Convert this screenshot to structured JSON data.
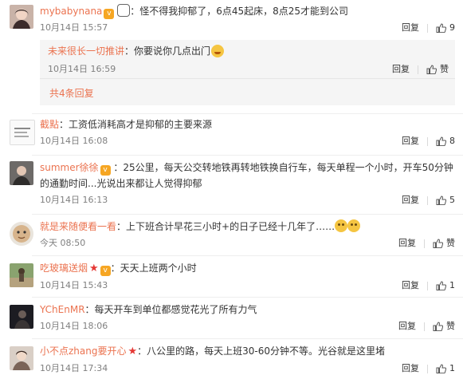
{
  "comments": [
    {
      "user": "mybabynana",
      "text": "：怪不得我抑郁了，6点45起床，8点25才能到公司",
      "time": "10月14日 15:57",
      "reply_label": "回复",
      "likes": "9",
      "sub": {
        "user": "未来很长一切推讲",
        "text": "：你要说你几点出门",
        "time": "10月14日 16:59",
        "reply_label": "回复",
        "like_label": "赞"
      },
      "more_replies": "共4条回复"
    },
    {
      "user": "截點",
      "text": "：工资低消耗高才是抑郁的主要来源",
      "time": "10月14日 16:08",
      "reply_label": "回复",
      "likes": "8"
    },
    {
      "user": "summer徐徐",
      "text": "：25公里，每天公交转地铁再转地铁换自行车，每天单程一个小时，开车50分钟",
      "text2": "的通勤时间...光说出来都让人觉得抑郁",
      "time": "10月14日 16:13",
      "reply_label": "回复",
      "likes": "5"
    },
    {
      "user": "就是来随便看一看",
      "text": "：上下班合计早花三小时+的日子已经十几年了……",
      "time": "今天 08:50",
      "reply_label": "回复",
      "like_label": "赞"
    },
    {
      "user": "吃玻璃送烟",
      "text": "：天天上班两个小时",
      "time": "10月14日 15:43",
      "reply_label": "回复",
      "likes": "1"
    },
    {
      "user": "YChEnMR",
      "text": "：每天开车到单位都感觉花光了所有力气",
      "time": "10月14日 18:06",
      "reply_label": "回复",
      "like_label": "赞"
    },
    {
      "user": "小不点zhang要开心",
      "text": "：八公里的路，每天上班30-60分钟不等。光谷就是这里堵",
      "time": "10月14日 17:34",
      "reply_label": "回复",
      "likes": "1"
    }
  ],
  "colors": {
    "username": "#eb7350",
    "meta": "#808080",
    "subbox": "#f5f5f5"
  }
}
